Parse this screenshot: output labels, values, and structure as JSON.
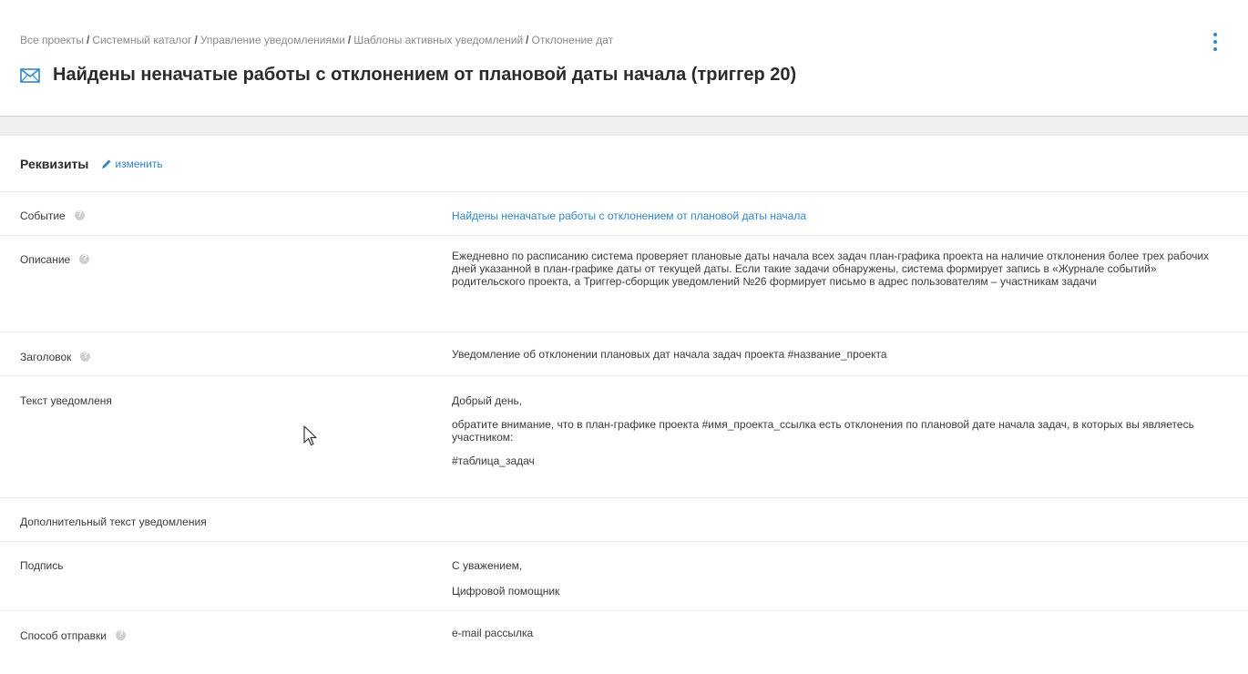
{
  "breadcrumb": [
    "Все проекты",
    "Системный каталог",
    "Управление уведомлениями",
    "Шаблоны активных уведомлений",
    "Отклонение дат"
  ],
  "breadcrumb_separator": "/",
  "title": "Найдены неначатые работы с отклонением от плановой даты начала (триггер 20)",
  "section": {
    "title": "Реквизиты",
    "edit_label": "изменить"
  },
  "fields": {
    "event": {
      "label": "Событие",
      "value": "Найдены неначатые работы с отклонением от плановой даты начала"
    },
    "description": {
      "label": "Описание",
      "value": "Ежедневно по расписанию система проверяет плановые даты начала всех задач план-графика проекта на наличие отклонения более трех рабочих дней указанной в план-графике даты от текущей даты. Если такие задачи обнаружены, система формирует запись в «Журнале событий» родительского проекта, а Триггер-сборщик уведомлений №26 формирует письмо в адрес пользователям – участникам задачи"
    },
    "subject": {
      "label": "Заголовок",
      "value": "Уведомление об отклонении плановых дат начала задач проекта #название_проекта"
    },
    "text": {
      "label": "Текст уведомленя",
      "greeting": "Добрый день,",
      "body": "обратите внимание, что в план-графике проекта #имя_проекта_ссылка есть отклонения по плановой дате начала задач, в которых вы являетесь участником:",
      "table": "#таблица_задач"
    },
    "additional_text": {
      "label": "Дополнительный текст уведомления",
      "value": ""
    },
    "signature": {
      "label": "Подпись",
      "line1": "С уважением,",
      "line2": "Цифровой помощник"
    },
    "delivery": {
      "label": "Способ отправки",
      "value": "e-mail рассылка"
    }
  },
  "colors": {
    "accent": "#2f86c8",
    "band": "#efefef",
    "divider": "#ebebeb"
  }
}
